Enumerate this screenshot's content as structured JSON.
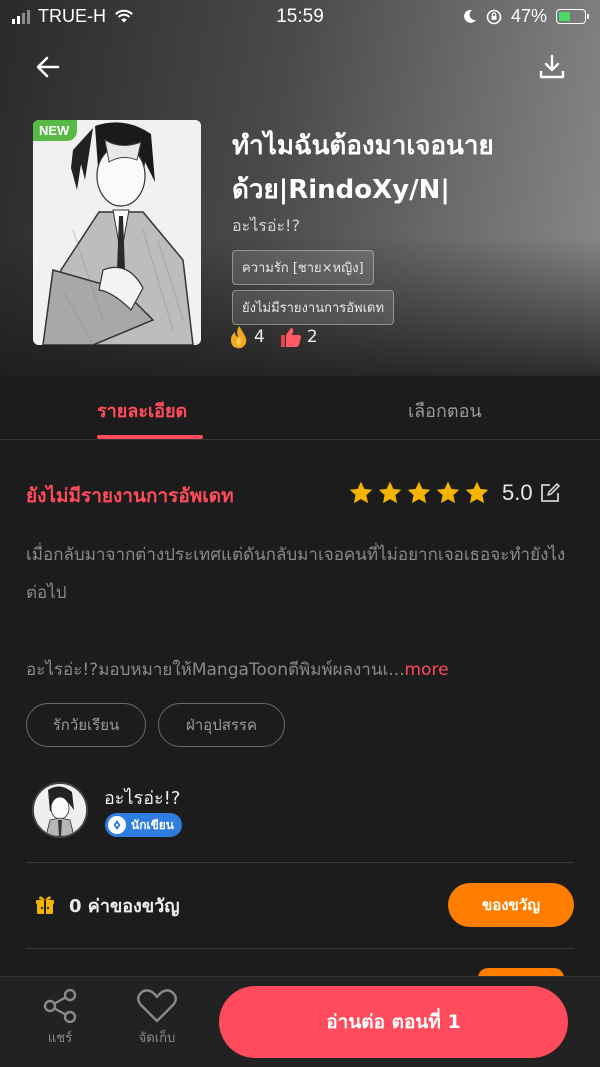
{
  "status_bar": {
    "carrier": "TRUE-H",
    "time": "15:59",
    "battery_percent": "47%",
    "battery_level": 0.47
  },
  "header": {
    "back_icon": "arrow-left-icon",
    "download_icon": "download-icon"
  },
  "book": {
    "new_badge": "NEW",
    "title": "ทำไมฉันต้องมาเจอนายด้วย|RindoXy/N|",
    "author": "อะไรอ่ะ!?",
    "category_tag": "ความรัก [ชาย×หญิง]",
    "update_tag": "ยังไม่มีรายงานการอัพเดท",
    "fire_count": "4",
    "like_count": "2"
  },
  "tabs": {
    "details": "รายละเอียด",
    "episodes": "เลือกตอน",
    "active": "details"
  },
  "details": {
    "update_status": "ยังไม่มีรายงานการอัพเดท",
    "rating_value": "5.0",
    "rating_stars": 5,
    "description": "เมื่อกลับมาจากต่างประเทศแต่ดันกลับมาเจอคนที่ไม่อยากเจอเธอจะทำยังไงต่อไป",
    "license_text": "อะไรอ่ะ!?มอบหมายให้MangaToonตีพิมพ์ผลงานเ...",
    "more_label": "more",
    "genres": [
      "รักวัยเรียน",
      "ฝ่าอุปสรรค"
    ]
  },
  "writer": {
    "name": "อะไรอ่ะ!?",
    "badge": "นักเขียน"
  },
  "gifts": {
    "count_label": "0 ค่าของขวัญ",
    "button_label": "ของขวัญ"
  },
  "bottom_bar": {
    "share_label": "แชร์",
    "collect_label": "จัดเก็บ",
    "read_button": "อ่านต่อ ตอนที่ 1"
  },
  "colors": {
    "accent": "#ff4b5c",
    "gift": "#ff7e00",
    "badge_green": "#58b947",
    "writer_badge": "#2f7de1",
    "star": "#f5b400"
  }
}
